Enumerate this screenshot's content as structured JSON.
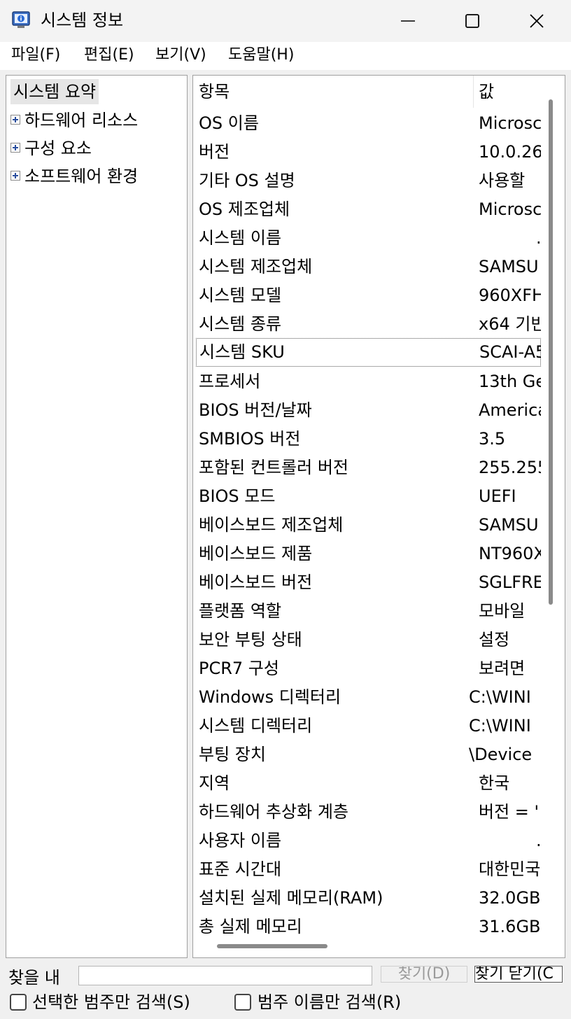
{
  "window": {
    "title": "시스템 정보",
    "icon": "system-info-icon",
    "controls": [
      "minimize-icon",
      "maximize-icon",
      "close-icon"
    ]
  },
  "menu": [
    {
      "label": "파일(F)"
    },
    {
      "label": "편집(E)"
    },
    {
      "label": "보기(V)"
    },
    {
      "label": "도움말(H)"
    }
  ],
  "tree": {
    "root": "시스템 요약",
    "nodes": [
      {
        "label": "하드웨어 리소스"
      },
      {
        "label": "구성 요소"
      },
      {
        "label": "소프트웨어 환경"
      }
    ]
  },
  "list": {
    "headers": {
      "item": "항목",
      "value": "값"
    },
    "rows": [
      {
        "item": "OS 이름",
        "value": "Microsc"
      },
      {
        "item": "버전",
        "value": "10.0.26"
      },
      {
        "item": "기타 OS 설명",
        "value": "사용할"
      },
      {
        "item": "OS 제조업체",
        "value": "Microsc"
      },
      {
        "item": "시스템 이름",
        "value": "."
      },
      {
        "item": "시스템 제조업체",
        "value": "SAMSU"
      },
      {
        "item": "시스템 모델",
        "value": "960XFH"
      },
      {
        "item": "시스템 종류",
        "value": "x64 기반"
      },
      {
        "item": "시스템 SKU",
        "value": "SCAI-A5"
      },
      {
        "item": "프로세서",
        "value": "13th Ge"
      },
      {
        "item": "BIOS 버전/날짜",
        "value": "America"
      },
      {
        "item": "SMBIOS 버전",
        "value": "3.5"
      },
      {
        "item": "포함된 컨트롤러 버전",
        "value": "255.255"
      },
      {
        "item": "BIOS 모드",
        "value": "UEFI"
      },
      {
        "item": "베이스보드 제조업체",
        "value": "SAMSU"
      },
      {
        "item": "베이스보드 제품",
        "value": "NT960X"
      },
      {
        "item": "베이스보드 버전",
        "value": "SGLFRE"
      },
      {
        "item": "플랫폼 역할",
        "value": "모바일"
      },
      {
        "item": "보안 부팅 상태",
        "value": "설정"
      },
      {
        "item": "PCR7 구성",
        "value": "보려면"
      },
      {
        "item": "Windows 디렉터리",
        "value": "C:\\WINI"
      },
      {
        "item": "시스템 디렉터리",
        "value": "C:\\WINI"
      },
      {
        "item": "부팅 장치",
        "value": "\\Device"
      },
      {
        "item": "지역",
        "value": "한국"
      },
      {
        "item": "하드웨어 추상화 계층",
        "value": "버전 = '"
      },
      {
        "item": "사용자 이름",
        "value": "."
      },
      {
        "item": "표준 시간대",
        "value": "대한민국"
      },
      {
        "item": "설치된 실제 메모리(RAM)",
        "value": "32.0GB"
      },
      {
        "item": "총 실제 메모리",
        "value": "31.6GB"
      }
    ]
  },
  "find": {
    "label": "찾을 내",
    "input_value": "",
    "find_button": "찾기(D)",
    "close_button": "찾기 닫기(C",
    "option_selected_only": "선택한 범주만 검색(S)",
    "option_names_only": "범주 이름만 검색(R)"
  }
}
